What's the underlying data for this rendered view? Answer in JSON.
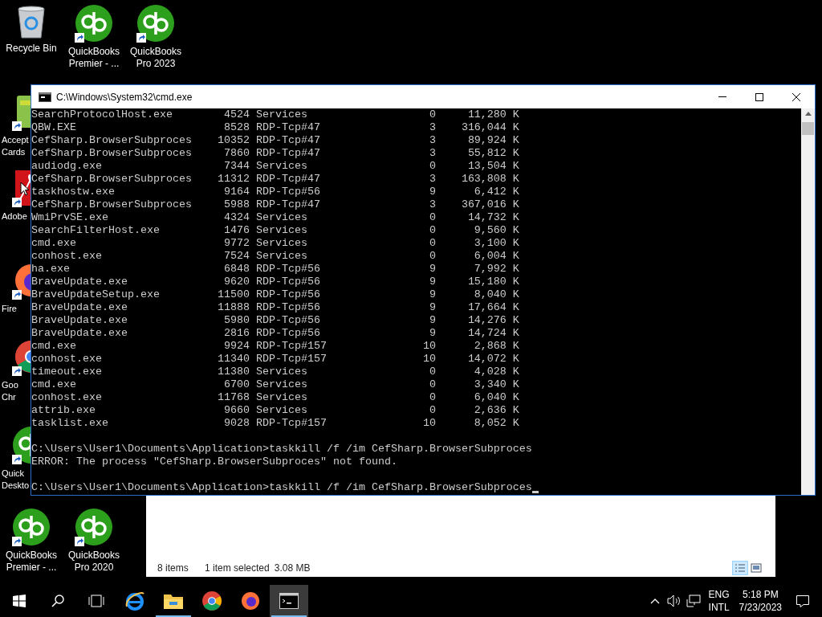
{
  "desktop_icons": [
    {
      "kind": "recycle",
      "lines": [
        "Recycle Bin"
      ]
    },
    {
      "kind": "qb",
      "lines": [
        "QuickBooks",
        "Premier - ..."
      ]
    },
    {
      "kind": "qb",
      "lines": [
        "QuickBooks",
        "Pro 2023"
      ]
    },
    {
      "kind": "cards",
      "lines": [
        "Accept",
        "Cards"
      ]
    },
    {
      "kind": "adobe",
      "lines": [
        "Adobe"
      ]
    },
    {
      "kind": "firefox",
      "lines": [
        "Fire"
      ]
    },
    {
      "kind": "chrome",
      "lines": [
        "Goo",
        "Chr"
      ]
    },
    {
      "kind": "qbdesk",
      "lines": [
        "Quick",
        "Deskto"
      ]
    },
    {
      "kind": "qb",
      "lines": [
        "QuickBooks",
        "Premier - ..."
      ]
    },
    {
      "kind": "qb",
      "lines": [
        "QuickBooks",
        "Pro 2020"
      ]
    }
  ],
  "explorer": {
    "item_count": "8 items",
    "selection": "1 item selected",
    "size": "3.08 MB",
    "views": [
      {
        "kind": "details",
        "selected": true
      },
      {
        "kind": "tiles",
        "selected": false
      }
    ]
  },
  "console": {
    "title": "C:\\Windows\\System32\\cmd.exe",
    "processes": [
      {
        "image": "SearchProtocolHost.exe",
        "pid": "4524",
        "session": "Services",
        "num": "0",
        "mem": "11,280 K"
      },
      {
        "image": "QBW.EXE",
        "pid": "8528",
        "session": "RDP-Tcp#47",
        "num": "3",
        "mem": "316,044 K"
      },
      {
        "image": "CefSharp.BrowserSubproces",
        "pid": "10352",
        "session": "RDP-Tcp#47",
        "num": "3",
        "mem": "89,924 K"
      },
      {
        "image": "CefSharp.BrowserSubproces",
        "pid": "7860",
        "session": "RDP-Tcp#47",
        "num": "3",
        "mem": "55,812 K"
      },
      {
        "image": "audiodg.exe",
        "pid": "7344",
        "session": "Services",
        "num": "0",
        "mem": "13,504 K"
      },
      {
        "image": "CefSharp.BrowserSubproces",
        "pid": "11312",
        "session": "RDP-Tcp#47",
        "num": "3",
        "mem": "163,808 K"
      },
      {
        "image": "taskhostw.exe",
        "pid": "9164",
        "session": "RDP-Tcp#56",
        "num": "9",
        "mem": "6,412 K"
      },
      {
        "image": "CefSharp.BrowserSubproces",
        "pid": "5988",
        "session": "RDP-Tcp#47",
        "num": "3",
        "mem": "367,016 K"
      },
      {
        "image": "WmiPrvSE.exe",
        "pid": "4324",
        "session": "Services",
        "num": "0",
        "mem": "14,732 K"
      },
      {
        "image": "SearchFilterHost.exe",
        "pid": "1476",
        "session": "Services",
        "num": "0",
        "mem": "9,560 K"
      },
      {
        "image": "cmd.exe",
        "pid": "9772",
        "session": "Services",
        "num": "0",
        "mem": "3,100 K"
      },
      {
        "image": "conhost.exe",
        "pid": "7524",
        "session": "Services",
        "num": "0",
        "mem": "6,004 K"
      },
      {
        "image": "ha.exe",
        "pid": "6848",
        "session": "RDP-Tcp#56",
        "num": "9",
        "mem": "7,992 K"
      },
      {
        "image": "BraveUpdate.exe",
        "pid": "9620",
        "session": "RDP-Tcp#56",
        "num": "9",
        "mem": "15,180 K"
      },
      {
        "image": "BraveUpdateSetup.exe",
        "pid": "11500",
        "session": "RDP-Tcp#56",
        "num": "9",
        "mem": "8,040 K"
      },
      {
        "image": "BraveUpdate.exe",
        "pid": "11888",
        "session": "RDP-Tcp#56",
        "num": "9",
        "mem": "17,664 K"
      },
      {
        "image": "BraveUpdate.exe",
        "pid": "5980",
        "session": "RDP-Tcp#56",
        "num": "9",
        "mem": "14,276 K"
      },
      {
        "image": "BraveUpdate.exe",
        "pid": "2816",
        "session": "RDP-Tcp#56",
        "num": "9",
        "mem": "14,724 K"
      },
      {
        "image": "cmd.exe",
        "pid": "9924",
        "session": "RDP-Tcp#157",
        "num": "10",
        "mem": "2,868 K"
      },
      {
        "image": "conhost.exe",
        "pid": "11340",
        "session": "RDP-Tcp#157",
        "num": "10",
        "mem": "14,072 K"
      },
      {
        "image": "timeout.exe",
        "pid": "11380",
        "session": "Services",
        "num": "0",
        "mem": "4,028 K"
      },
      {
        "image": "cmd.exe",
        "pid": "6700",
        "session": "Services",
        "num": "0",
        "mem": "3,340 K"
      },
      {
        "image": "conhost.exe",
        "pid": "11768",
        "session": "Services",
        "num": "0",
        "mem": "6,040 K"
      },
      {
        "image": "attrib.exe",
        "pid": "9660",
        "session": "Services",
        "num": "0",
        "mem": "2,636 K"
      },
      {
        "image": "tasklist.exe",
        "pid": "9028",
        "session": "RDP-Tcp#157",
        "num": "10",
        "mem": "8,052 K"
      }
    ],
    "output": [
      "C:\\Users\\User1\\Documents\\Application>taskkill /f /im CefSharp.BrowserSubproces",
      "ERROR: The process \"CefSharp.BrowserSubproces\" not found."
    ],
    "input": "C:\\Users\\User1\\Documents\\Application>taskkill /f /im CefSharp.BrowserSubproces"
  },
  "taskbar": {
    "apps": [
      {
        "kind": "ie",
        "running": false,
        "selected": false
      },
      {
        "kind": "explorer",
        "running": true,
        "selected": false
      },
      {
        "kind": "chrome",
        "running": false,
        "selected": false
      },
      {
        "kind": "firefox",
        "running": false,
        "selected": false
      },
      {
        "kind": "cmd",
        "running": true,
        "selected": true
      }
    ],
    "language": [
      "ENG",
      "INTL"
    ],
    "time": "5:18 PM",
    "date": "7/23/2023"
  }
}
